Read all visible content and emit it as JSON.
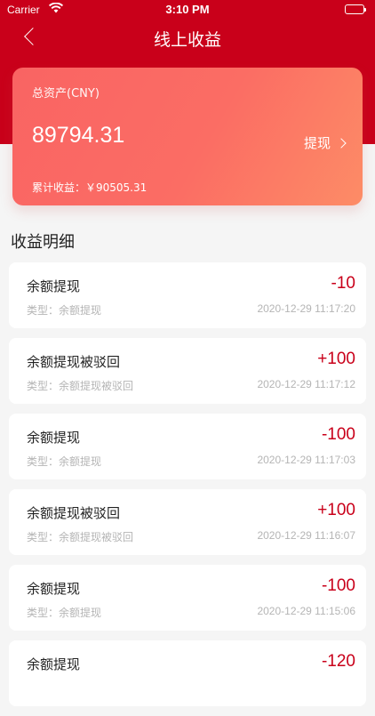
{
  "status": {
    "carrier": "Carrier",
    "time": "3:10 PM"
  },
  "nav": {
    "title": "线上收益"
  },
  "card": {
    "total_label": "总资产(CNY)",
    "total_value": "89794.31",
    "withdraw_label": "提现",
    "cumulative": "累计收益：￥90505.31"
  },
  "section_title": "收益明细",
  "colors": {
    "brand_red": "#c9001a",
    "card_gradient_start": "#f96463",
    "card_gradient_end": "#fd8c66"
  },
  "records": [
    {
      "title": "余额提现",
      "amount": "-10",
      "type": "类型：余额提现",
      "date": "2020-12-29 11:17:20"
    },
    {
      "title": "余额提现被驳回",
      "amount": "+100",
      "type": "类型：余额提现被驳回",
      "date": "2020-12-29 11:17:12"
    },
    {
      "title": "余额提现",
      "amount": "-100",
      "type": "类型：余额提现",
      "date": "2020-12-29 11:17:03"
    },
    {
      "title": "余额提现被驳回",
      "amount": "+100",
      "type": "类型：余额提现被驳回",
      "date": "2020-12-29 11:16:07"
    },
    {
      "title": "余额提现",
      "amount": "-100",
      "type": "类型：余额提现",
      "date": "2020-12-29 11:15:06"
    },
    {
      "title": "余额提现",
      "amount": "-120",
      "type": "",
      "date": ""
    }
  ]
}
